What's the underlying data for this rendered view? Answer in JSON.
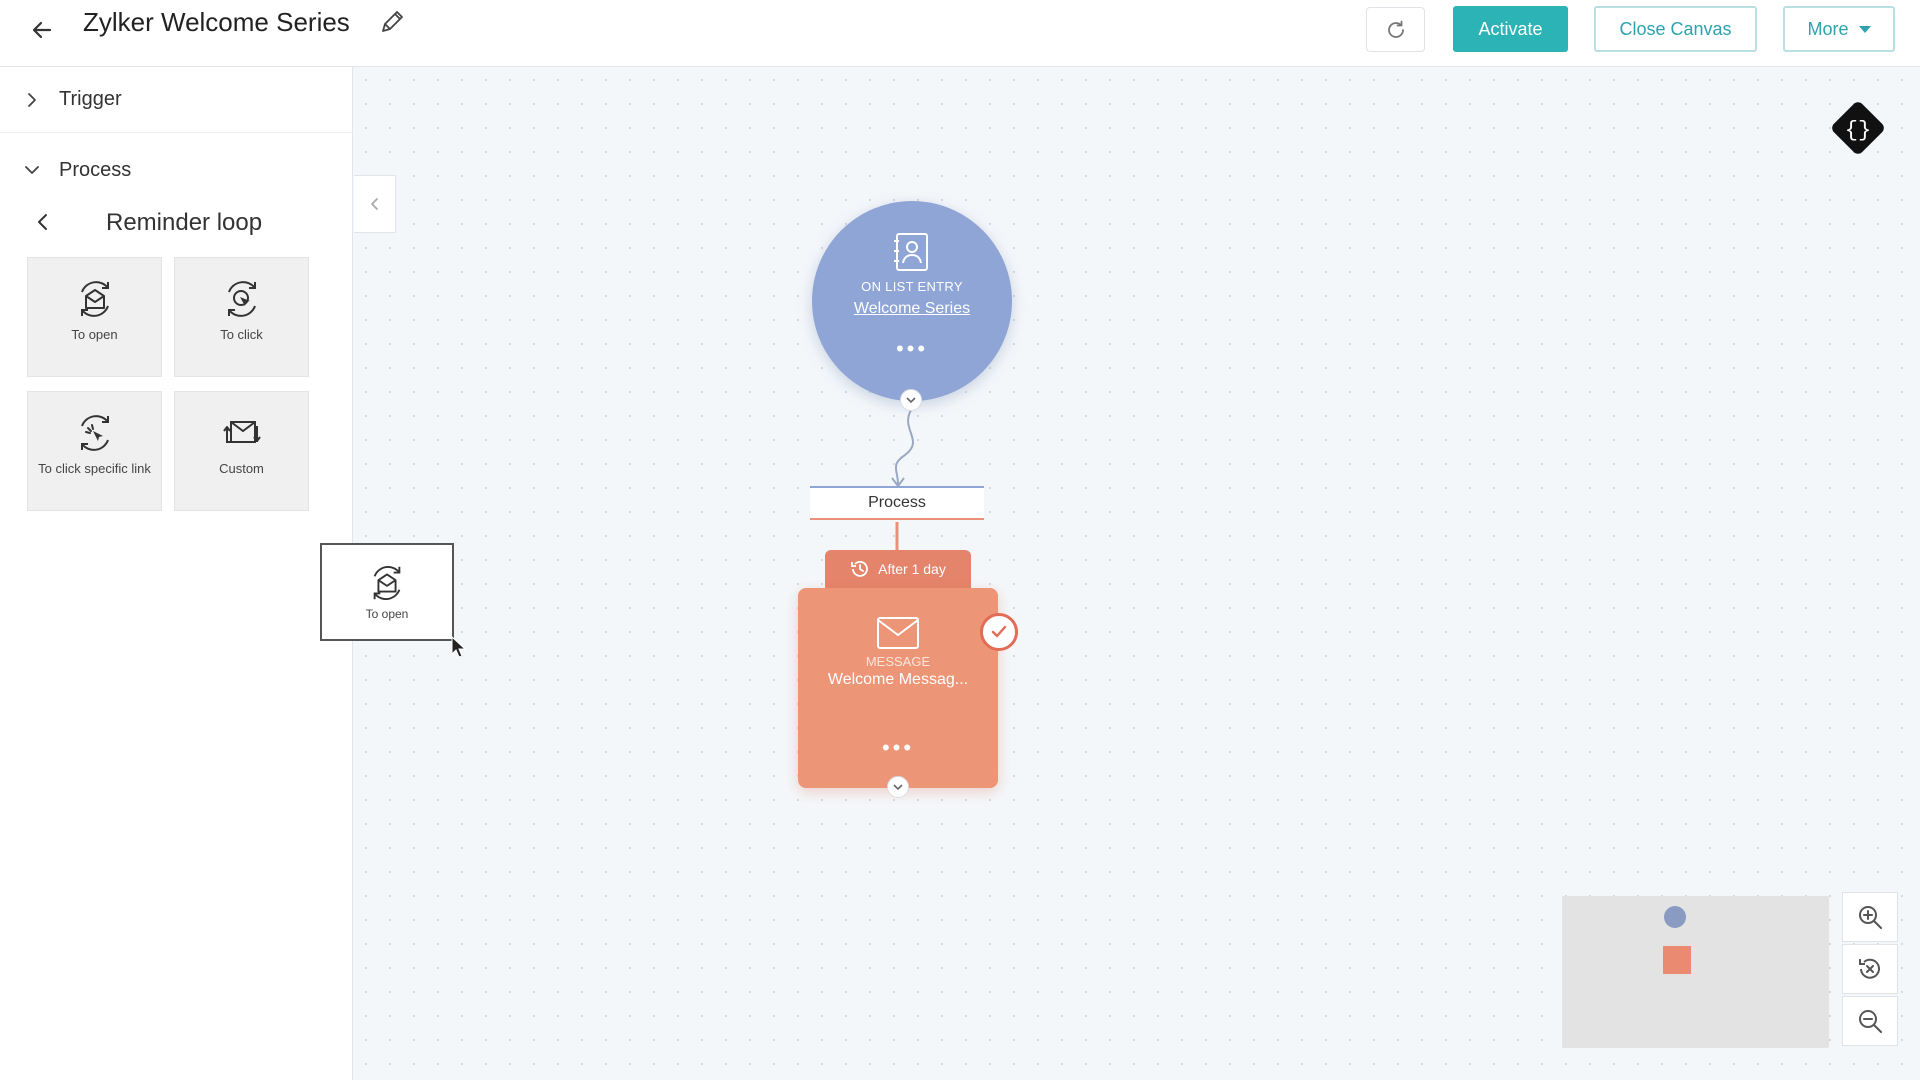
{
  "header": {
    "title": "Zylker Welcome Series",
    "activate_label": "Activate",
    "close_label": "Close Canvas",
    "more_label": "More"
  },
  "sidebar": {
    "trigger_label": "Trigger",
    "process_label": "Process",
    "subsection_title": "Reminder loop",
    "tiles": [
      {
        "label": "To open",
        "icon": "envelope-open-loop-icon"
      },
      {
        "label": "To click",
        "icon": "click-loop-icon"
      },
      {
        "label": "To click specific link",
        "icon": "link-click-loop-icon"
      },
      {
        "label": "Custom",
        "icon": "custom-loop-icon"
      }
    ]
  },
  "canvas": {
    "drag_ghost_label": "To open",
    "start_node": {
      "kicker": "ON LIST ENTRY",
      "link": "Welcome Series",
      "color": "#8ea5d6"
    },
    "process_label": "Process",
    "delay_label": "After 1 day",
    "message_node": {
      "kicker": "MESSAGE",
      "title": "Welcome Messag...",
      "color": "#ec9577"
    }
  },
  "colors": {
    "accent": "#2bb3b5",
    "accent_border": "#b9dfe2"
  }
}
